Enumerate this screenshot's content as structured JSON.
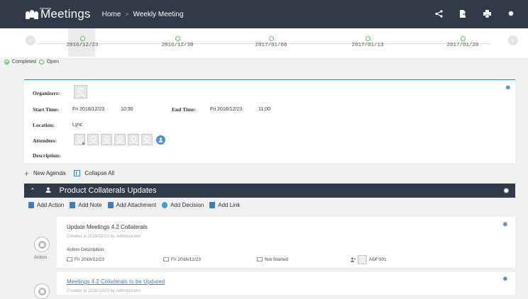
{
  "header": {
    "brand_tag": "Kaimeng",
    "brand_name": "Meetings",
    "breadcrumb": [
      "Home",
      "Weekly Meeting"
    ],
    "breadcrumb_sep": ">"
  },
  "timeline": {
    "dates": [
      "2016/12/23",
      "2016/12/30",
      "2017/01/06",
      "2017/01/13",
      "2017/01/20"
    ],
    "selected": "2016/12/23"
  },
  "legend": {
    "completed": "Completed",
    "open": "Open"
  },
  "meeting": {
    "organizers_label": "Organizers:",
    "start_label": "Start Time:",
    "start_date": "Fri 2016/12/23",
    "start_time": "10:30",
    "end_label": "End Time:",
    "end_date": "Fri 2016/12/23",
    "end_time": "11:00",
    "location_label": "Location:",
    "location": "Lync",
    "attendees_label": "Attendees:",
    "attendee_count": 6,
    "description_label": "Description:"
  },
  "agenda_actions": {
    "new_agenda": "New Agenda",
    "collapse_all": "Collapse All"
  },
  "agenda": {
    "title": "Product Collaterals Updates",
    "tools": [
      "Add Action",
      "Add Note",
      "Add Attachment",
      "Add Decision",
      "Add Link"
    ]
  },
  "cards": [
    {
      "title": "Update Meetings 4.2 Collaterals",
      "meta": "Created at  2016/12/23  by  Administrator",
      "type_label": "Action",
      "desc_label": "Action Description",
      "start": "Fri 2016/12/23",
      "due": "Fri 2016/12/23",
      "status": "Not Started",
      "assignee": "ADFS01"
    },
    {
      "title": "Meetings 4.2 Collaterals to be Updated",
      "meta": "Created at  2016/12/23  by  Administrator"
    }
  ],
  "colors": {
    "header_bg": "#303a48",
    "accent": "#3a7ebf",
    "completed": "#5cb85c"
  }
}
